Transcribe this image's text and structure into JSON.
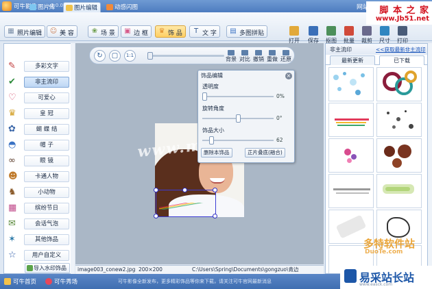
{
  "titlebar": {
    "app_title": "可牛影像",
    "version": "v2.0.0.1003",
    "net_link": "网站",
    "window_buttons": "意 _ ×"
  },
  "nav": {
    "tabs": [
      {
        "label": "图片库",
        "active": false
      },
      {
        "label": "图片编辑",
        "active": true
      },
      {
        "label": "动感闪图",
        "active": false
      }
    ]
  },
  "toolbar": {
    "tools": [
      {
        "label": "照片编辑",
        "icon": "photo-edit-icon",
        "active": false
      },
      {
        "label": "美 容",
        "icon": "beauty-icon",
        "active": false
      },
      {
        "label": "场 景",
        "icon": "scene-icon",
        "active": false
      },
      {
        "label": "边 框",
        "icon": "frame-icon",
        "active": false
      },
      {
        "label": "饰 品",
        "icon": "accessory-icon",
        "active": true
      },
      {
        "label": "文 字",
        "icon": "text-icon",
        "active": false
      },
      {
        "label": "多图拼贴",
        "icon": "collage-icon",
        "active": false
      }
    ],
    "right_tools": [
      {
        "label": "打开",
        "icon": "open-icon"
      },
      {
        "label": "保存",
        "icon": "save-icon"
      },
      {
        "label": "抠图",
        "icon": "cutout-icon"
      },
      {
        "label": "批量",
        "icon": "batch-icon"
      },
      {
        "label": "裁剪",
        "icon": "crop-icon"
      },
      {
        "label": "尺寸",
        "icon": "resize-icon"
      },
      {
        "label": "打印",
        "icon": "print-icon"
      }
    ]
  },
  "left_panel": {
    "categories": [
      {
        "label": "多彩文字",
        "icon": "colorful-text-icon",
        "active": false
      },
      {
        "label": "非主流印",
        "icon": "alt-stamp-icon",
        "active": true
      },
      {
        "label": "可爱心",
        "icon": "heart-icon",
        "active": false
      },
      {
        "label": "皇 冠",
        "icon": "crown-icon",
        "active": false
      },
      {
        "label": "蝴 蝶 结",
        "icon": "bow-icon",
        "active": false
      },
      {
        "label": "帽 子",
        "icon": "hat-icon",
        "active": false
      },
      {
        "label": "眼 镜",
        "icon": "glasses-icon",
        "active": false
      },
      {
        "label": "卡通人物",
        "icon": "cartoon-icon",
        "active": false
      },
      {
        "label": "小动物",
        "icon": "animal-icon",
        "active": false
      },
      {
        "label": "缤纷节日",
        "icon": "festival-icon",
        "active": false
      },
      {
        "label": "会话气泡",
        "icon": "bubble-icon",
        "active": false
      },
      {
        "label": "其他饰品",
        "icon": "other-icon",
        "active": false
      },
      {
        "label": "用户自定义",
        "icon": "star-icon",
        "active": false
      }
    ],
    "import_label": "导入水印饰品"
  },
  "canvas": {
    "controls": {
      "rotate": "↻",
      "fit": "▢",
      "actual": "1:1",
      "zoom_level": 0,
      "background_label": "背景",
      "compare_label": "对比",
      "undo_label": "撤销",
      "redo_label": "重做",
      "restore_label": "还原"
    },
    "watermark_text": "www.mi.ee.com"
  },
  "dialog": {
    "title": "饰品编辑",
    "opacity_label": "透明度",
    "opacity_value": "0%",
    "opacity_level": 0,
    "rotation_label": "旋转角度",
    "rotation_value": "0°",
    "rotation_level": 0.5,
    "size_label": "饰品大小",
    "size_value": "62",
    "size_level": 0.1,
    "delete_button": "删除本饰品",
    "apply_button": "正片叠底(融合)"
  },
  "path_bar": {
    "filename": "image003_conew2.jpg",
    "dimensions": "200×200",
    "path": "C:\\Users\\Spring\\Documents\\gongzuo\\青边"
  },
  "right_panel": {
    "category": "非主流印",
    "more_link": "&lt;&lt;获取最新非主流印",
    "tabs": [
      {
        "label": "最新更新",
        "active": false
      },
      {
        "label": "已下载",
        "active": true
      }
    ]
  },
  "footer": {
    "home_label": "可牛首页",
    "show_label": "可牛秀场",
    "news_text": "可牛影像全新发布，更多精彩饰品等你来下载，请关注可牛官网最新消息"
  },
  "watermarks": {
    "top_right_line1": "脚 本 之 家",
    "top_right_line2": "www.Jb51.net",
    "mid_right_line1": "多特软件站",
    "mid_right_line2": "DuoTe.com",
    "bottom_right_line1": "易采站长站",
    "bottom_right_line2": "www.easck.com"
  },
  "colors": {
    "title_bar": "#4d7cbf",
    "active_tool": "#ffcf63",
    "selection_box": "#3b3bd4",
    "canvas_bg": "#aab7c6",
    "watermark_red": "#d2121e"
  }
}
